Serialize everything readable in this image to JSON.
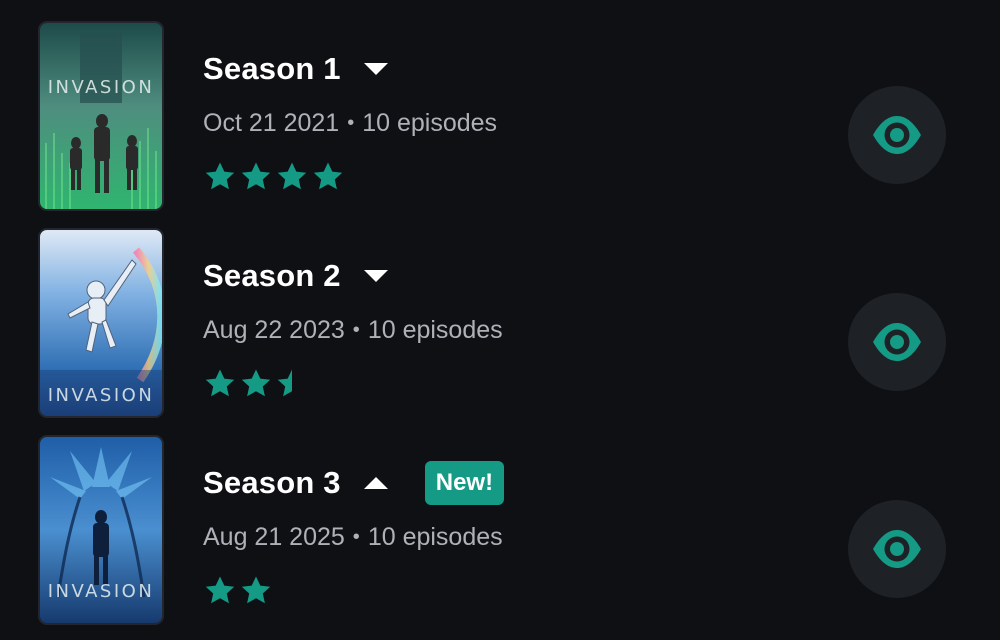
{
  "accent_color": "#149a85",
  "seasons": [
    {
      "title": "Season 1",
      "caret": "chevron-down-icon",
      "date": "Oct 21 2021",
      "separator": "•",
      "episodes": "10 episodes",
      "rating_stars": 4,
      "badge": "",
      "poster_text": "INVASION",
      "watch_icon": "eye-icon"
    },
    {
      "title": "Season 2",
      "caret": "chevron-down-icon",
      "date": "Aug 22 2023",
      "separator": "•",
      "episodes": "10 episodes",
      "rating_stars": 2.5,
      "badge": "",
      "poster_text": "INVASION",
      "watch_icon": "eye-icon"
    },
    {
      "title": "Season 3",
      "caret": "chevron-up-icon",
      "date": "Aug 21 2025",
      "separator": "•",
      "episodes": "10 episodes",
      "rating_stars": 2,
      "badge": "New!",
      "poster_text": "INVASION",
      "watch_icon": "eye-icon"
    }
  ]
}
